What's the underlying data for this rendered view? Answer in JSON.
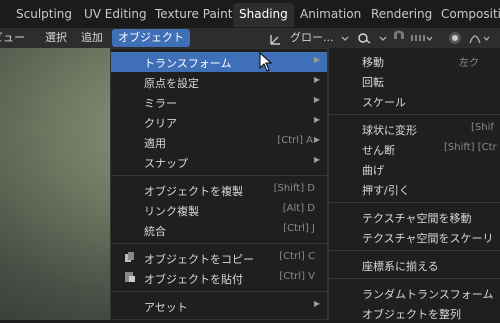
{
  "tabs": [
    "Sculpting",
    "UV Editing",
    "Texture Paint",
    "Shading",
    "Animation",
    "Rendering",
    "Compositing"
  ],
  "menubar": {
    "view": "ビュー",
    "select": "選択",
    "add": "追加",
    "object": "オブジェクト"
  },
  "toolbar": {
    "transform_orientation": "グロー..."
  },
  "menu": [
    {
      "label": "トランスフォーム",
      "shortcut": "",
      "submenu": true,
      "highlight": true
    },
    {
      "label": "原点を設定",
      "shortcut": "",
      "submenu": true
    },
    {
      "label": "ミラー",
      "shortcut": "",
      "submenu": true
    },
    {
      "label": "クリア",
      "shortcut": "",
      "submenu": true
    },
    {
      "label": "適用",
      "shortcut": "[Ctrl] A",
      "submenu": true
    },
    {
      "label": "スナップ",
      "shortcut": "",
      "submenu": true
    },
    {
      "label": "オブジェクトを複製",
      "shortcut": "[Shift] D"
    },
    {
      "label": "リンク複製",
      "shortcut": "[Alt] D"
    },
    {
      "label": "統合",
      "shortcut": "[Ctrl] J"
    },
    {
      "label": "オブジェクトをコピー",
      "shortcut": "[Ctrl] C",
      "icon": "copy-icon"
    },
    {
      "label": "オブジェクトを貼付",
      "shortcut": "[Ctrl] V",
      "icon": "paste-icon"
    },
    {
      "label": "アセット",
      "shortcut": "",
      "submenu": true
    }
  ],
  "submenu": [
    {
      "label": "移動",
      "shortcut": "左ク"
    },
    {
      "label": "回転",
      "shortcut": ""
    },
    {
      "label": "スケール",
      "shortcut": ""
    },
    {
      "label": "球状に変形",
      "shortcut": "[Shif"
    },
    {
      "label": "せん断",
      "shortcut": "[Shift] [Ctr"
    },
    {
      "label": "曲げ",
      "shortcut": ""
    },
    {
      "label": "押す/引く",
      "shortcut": ""
    },
    {
      "label": "テクスチャ空間を移動",
      "shortcut": ""
    },
    {
      "label": "テクスチャ空間をスケーリ",
      "shortcut": ""
    },
    {
      "label": "座標系に揃える",
      "shortcut": ""
    },
    {
      "label": "ランダムトランスフォーム",
      "shortcut": ""
    },
    {
      "label": "オブジェクトを整列",
      "shortcut": ""
    }
  ],
  "colors": {
    "accent": "#3f6fb7",
    "menu_bg": "#1f1f1f",
    "header_bg": "#2d2d2d"
  }
}
